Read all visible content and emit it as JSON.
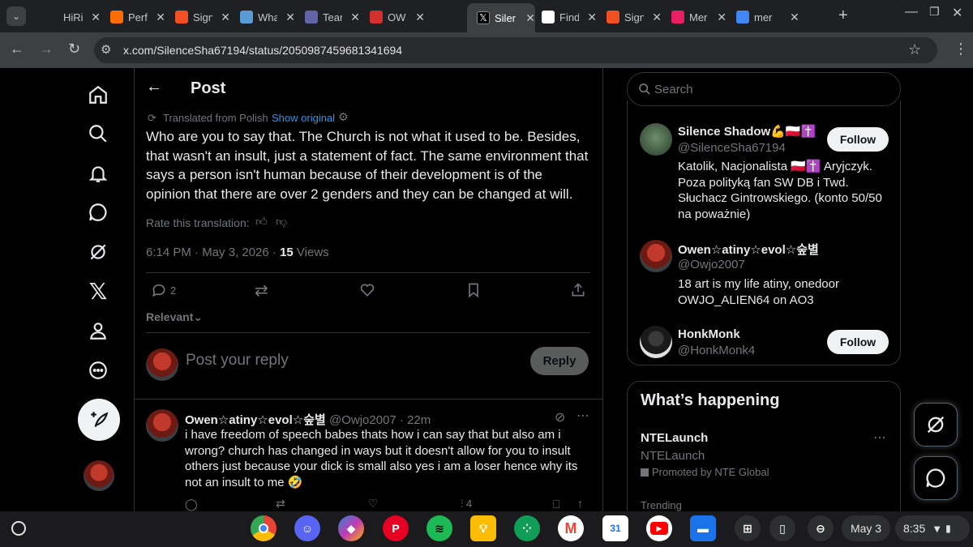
{
  "browser": {
    "tabs": [
      {
        "label": "HiRi",
        "color": "#1f2023"
      },
      {
        "label": "Perf",
        "color": "#ff6d00"
      },
      {
        "label": "Sign",
        "color": "#f25022"
      },
      {
        "label": "Wha",
        "color": "#5b9bd5"
      },
      {
        "label": "Tear",
        "color": "#6264a7"
      },
      {
        "label": "OW",
        "color": "#d32f2f"
      },
      {
        "label": "Siler",
        "color": "#000000"
      },
      {
        "label": "Find",
        "color": "#ffffff"
      },
      {
        "label": "Sign",
        "color": "#f25022"
      },
      {
        "label": "Mer",
        "color": "#e91e63"
      },
      {
        "label": "mer",
        "color": "#4285f4"
      }
    ],
    "url": "x.com/SilenceSha67194/status/2050987459681341694"
  },
  "post": {
    "header_title": "Post",
    "translated_label": "Translated from Polish",
    "show_original": "Show original",
    "body": "Who are you to say that. The Church is not what it used to be. Besides, that wasn't an insult, just a statement of fact. The same environment that says a person isn't human because of their development is of the opinion that there are over 2 genders and they can be changed at will.",
    "rate_label": "Rate this translation:",
    "timestamp": "6:14 PM · May 3, 2026 · ",
    "views_count": "15",
    "views_label": " Views",
    "reply_count": "2",
    "sort_label": "Relevant",
    "reply_placeholder": "Post your reply",
    "reply_button": "Reply"
  },
  "reply": {
    "name": "Owen☆atiny☆evol☆숲별",
    "handle": "@Owjo2007 · 22m",
    "text": "i have freedom of speech babes thats how i can say that  but also am i wrong? church has changed in ways but it doesn't allow for you to insult others just because your dick is small also yes i am a loser hence why its not an insult to me 🤣",
    "views": "4"
  },
  "sidebar": {
    "search_placeholder": "Search",
    "people": [
      {
        "name": "Silence Shadow💪🇵🇱✝️",
        "handle": "@SilenceSha67194",
        "bio": "Katolik, Nacjonalista 🇵🇱✝️ Aryjczyk. Poza polityką fan SW DB i Twd. Słuchacz Gintrowskiego. (konto 50/50 na poważnie)",
        "follow": "Follow"
      },
      {
        "name": "Owen☆atiny☆evol☆숲별",
        "handle": "@Owjo2007",
        "bio": "18 art is my life atiny, onedoor OWJO_ALIEN64 on AO3",
        "follow": ""
      },
      {
        "name": "HonkMonk",
        "handle": "@HonkMonk4",
        "bio": "",
        "follow": "Follow"
      }
    ],
    "happening_title": "What’s happening",
    "trend_title": "NTELaunch",
    "trend_subtitle": "NTELaunch",
    "promoted": "Promoted by NTE Global",
    "trending_label": "Trending"
  },
  "shelf": {
    "date": "May 3",
    "time": "8:35"
  }
}
